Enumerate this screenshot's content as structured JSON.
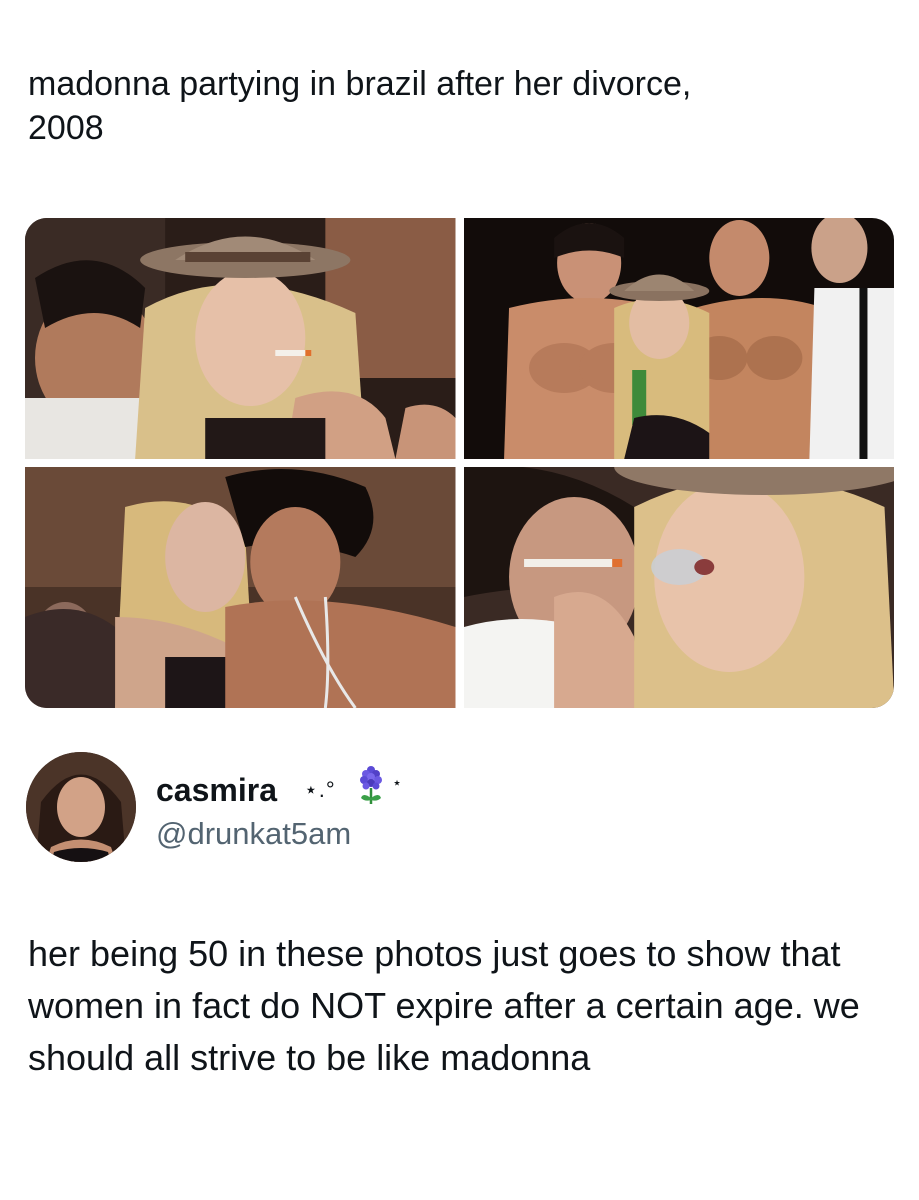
{
  "post": {
    "caption": "madonna partying in brazil after her divorce,\n2008"
  },
  "photos": [
    {
      "name": "photo-1"
    },
    {
      "name": "photo-2"
    },
    {
      "name": "photo-3"
    },
    {
      "name": "photo-4"
    }
  ],
  "quoted_tweet": {
    "display_name": "casmira",
    "name_decoration": "⋆.°",
    "name_tail": "⋆",
    "handle": "@drunkat5am",
    "text": "her being 50 in these photos just goes to show that women in fact do NOT expire after a certain age. we should all strive to be like madonna"
  },
  "icons": {
    "flower": "hyacinth-flower-icon"
  },
  "colors": {
    "text": "#0f1419",
    "secondary_text": "#536471",
    "background": "#ffffff"
  }
}
